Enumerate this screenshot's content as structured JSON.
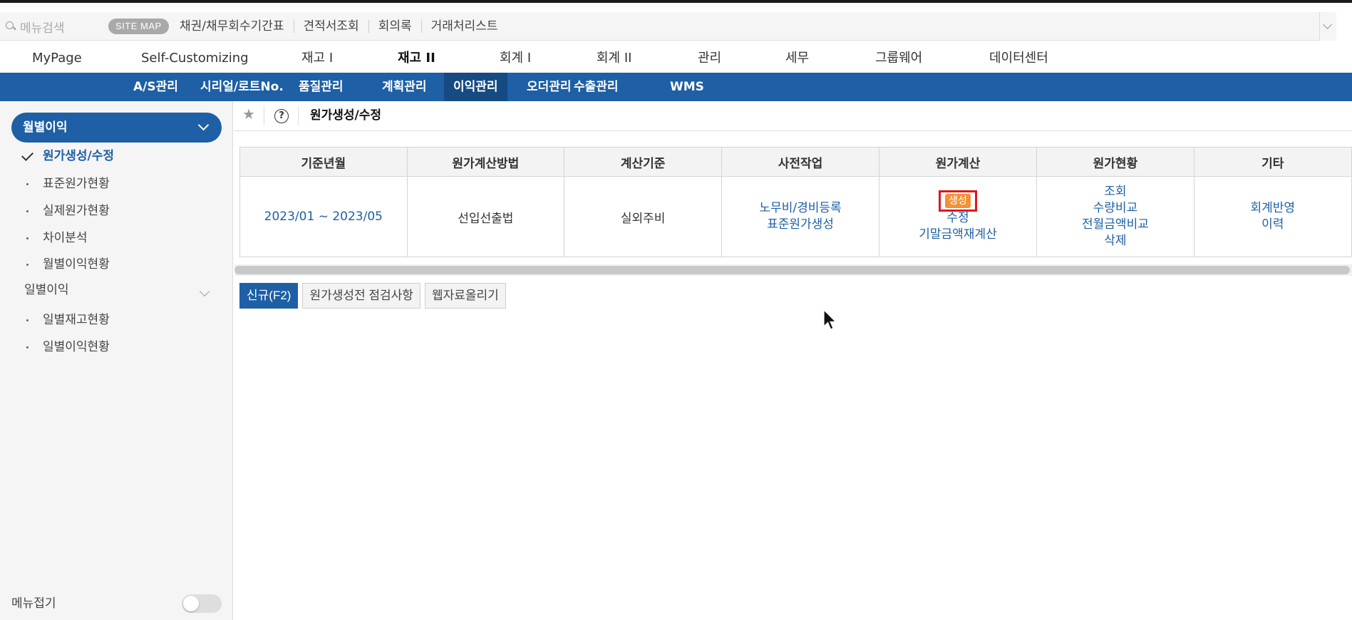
{
  "quickbar": {
    "search_placeholder": "메뉴검색",
    "sitemap_label": "SITE MAP",
    "links": [
      "채권/채무회수기간표",
      "견적서조회",
      "회의록",
      "거래처리스트"
    ]
  },
  "main_nav": {
    "items": [
      "MyPage",
      "Self-Customizing",
      "재고 I",
      "재고 II",
      "회계 I",
      "회계 II",
      "관리",
      "세무",
      "그룹웨어",
      "데이터센터"
    ],
    "active": "재고 II"
  },
  "sub_nav": {
    "items": [
      "A/S관리",
      "시리얼/로트No.",
      "품질관리",
      "계획관리",
      "이익관리",
      "오더관리",
      "수출관리",
      "WMS"
    ],
    "active": "이익관리"
  },
  "sidebar": {
    "group1_label": "월별이익",
    "group1_items": [
      "원가생성/수정",
      "표준원가현황",
      "실제원가현황",
      "차이분석",
      "월별이익현황"
    ],
    "current_item": "원가생성/수정",
    "group2_label": "일별이익",
    "group2_items": [
      "일별재고현황",
      "일별이익현황"
    ],
    "footer_label": "메뉴접기"
  },
  "content": {
    "title": "원가생성/수정",
    "table": {
      "headers": [
        "기준년월",
        "원가계산방법",
        "계산기준",
        "사전작업",
        "원가계산",
        "원가현황",
        "기타"
      ],
      "row": {
        "period": "2023/01 ~ 2023/05",
        "method": "선입선출법",
        "basis": "실외주비",
        "pre_work": [
          "노무비/경비등록",
          "표준원가생성"
        ],
        "calc_badge": "생성",
        "calc_items": [
          "수정",
          "기말금액재계산"
        ],
        "status": [
          "조회",
          "수량비교",
          "전월금액비교",
          "삭제"
        ],
        "etc": [
          "회계반영",
          "이력"
        ]
      }
    },
    "buttons": [
      "신규(F2)",
      "원가생성전 점검사항",
      "웹자료올리기"
    ]
  },
  "colors": {
    "primary_blue": "#1e5fa5",
    "active_sub_nav": "#164a82",
    "badge_orange": "#f0923a",
    "highlight_red": "#e0161d"
  }
}
